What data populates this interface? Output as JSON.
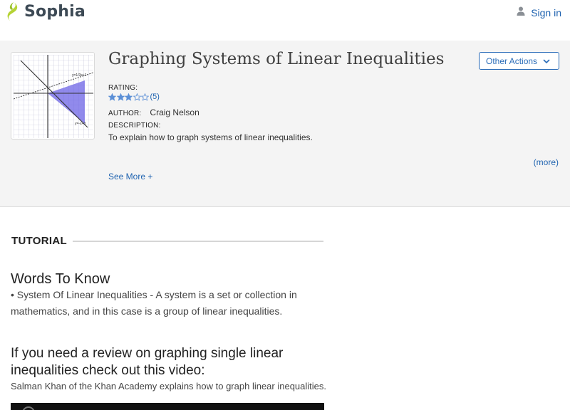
{
  "header": {
    "brand": "Sophia",
    "signin_label": "Sign in",
    "logo_icon": "sophia-leaf-icon",
    "user_icon": "user-icon"
  },
  "resource": {
    "title": "Graphing Systems of Linear Inequalities",
    "actions_label": "Other Actions",
    "rating_label": "RATING:",
    "rating_stars": 3,
    "rating_max": 5,
    "rating_count": "(5)",
    "author_label": "AUTHOR:",
    "author_name": "Craig Nelson",
    "description_label": "DESCRIPTION:",
    "description": "To explain how to graph systems of linear inequalities.",
    "more_link": "(more)",
    "see_more": "See More +",
    "thumbnail": {
      "line1_label": "y=1/3x+1",
      "line2_label": "y=-x+3"
    }
  },
  "tutorial": {
    "section_label": "TUTORIAL",
    "words_heading": "Words To Know",
    "words_body": "• System Of Linear Inequalities - A system is a set or collection in mathematics, and in this case is a group of linear inequalities.",
    "review_heading": "If you need a review on graphing single linear inequalities check out this video:",
    "review_sub": "Salman Khan of the Khan Academy explains how to graph linear inequalities."
  },
  "colors": {
    "accent": "#1f63b0",
    "brand_green": "#b5d334",
    "star_fill": "#5b8fd6",
    "shade": "#6c63e6"
  }
}
